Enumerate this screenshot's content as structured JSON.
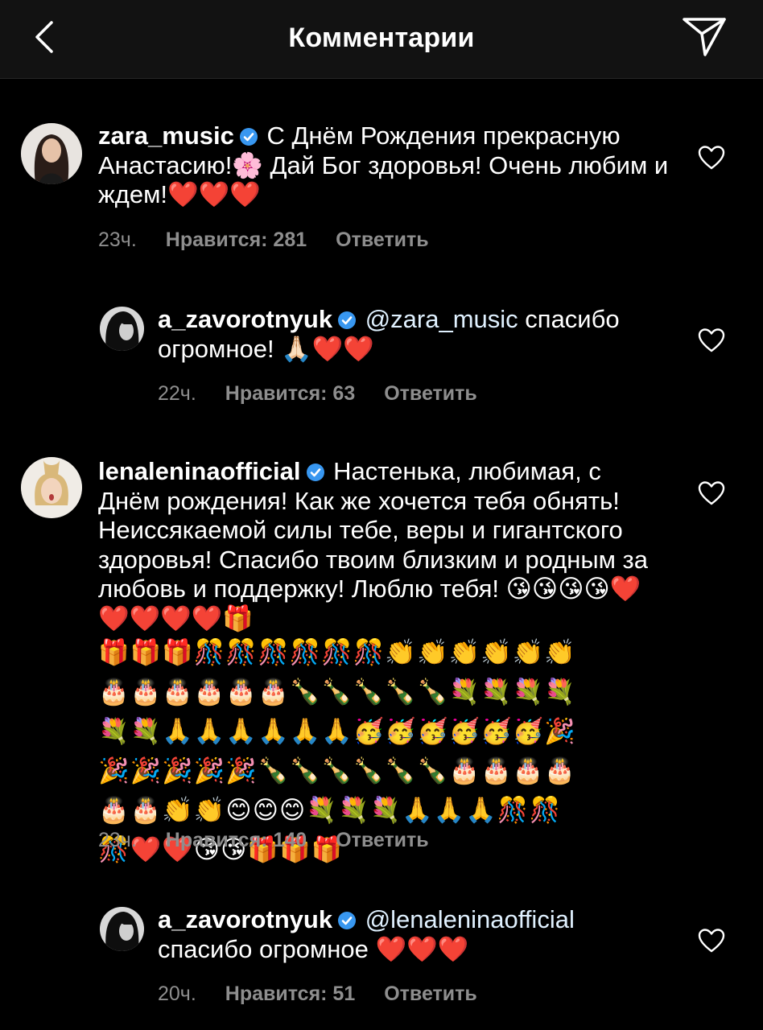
{
  "header": {
    "title": "Комментарии"
  },
  "comments": [
    {
      "username": "zara_music",
      "text": "С Днём Рождения прекрасную Анастасию!🌸 Дай Бог здоровья! Очень любим и ждем!❤️❤️❤️",
      "time": "23ч.",
      "likes": "Нравится: 281",
      "reply": "Ответить"
    },
    {
      "username": "a_zavorotnyuk",
      "mention": "@zara_music",
      "text": " спасибо огромное! 🙏🏻❤️❤️",
      "time": "22ч.",
      "likes": "Нравится: 63",
      "reply": "Ответить"
    },
    {
      "username": "lenaleninaofficial",
      "text": "Настенька, любимая, с Днём рождения! Как же хочется тебя обнять! Неиссякаемой силы тебе, веры и гигантского здоровья! Спасибо твоим близким и родным за любовь и поддержку! Люблю тебя! 😘😘😘😘❤️❤️❤️❤️❤️🎁",
      "emoji_lines": [
        "🎁🎁🎁🎊🎊🎊🎊🎊🎊👏👏👏👏👏👏",
        "🎂🎂🎂🎂🎂🎂🍾🍾🍾🍾🍾💐💐💐💐",
        "💐💐🙏🙏🙏🙏🙏🙏🥳🥳🥳🥳🥳🥳🎉",
        "🎉🎉🎉🎉🎉🍾🍾🍾🍾🍾🍾🎂🎂🎂🎂",
        "🎂🎂👏👏😊😊😊💐💐💐🙏🙏🙏🎊🎊",
        "🎊❤️❤️😘😘🎁🎁🎁"
      ],
      "time": "23ч.",
      "likes": "Нравится: 140",
      "reply": "Ответить"
    },
    {
      "username": "a_zavorotnyuk",
      "mention": "@lenaleninaofficial",
      "text": " спасибо огромное ❤️❤️❤️",
      "time": "20ч.",
      "likes": "Нравится: 51",
      "reply": "Ответить"
    }
  ],
  "colors": {
    "background": "#000000",
    "header": "#121212",
    "meta_text": "#8e8e8e",
    "verified": "#3897f0"
  },
  "icons": [
    "back-arrow-icon",
    "direct-send-icon",
    "verified-badge-icon",
    "heart-outline-icon"
  ]
}
